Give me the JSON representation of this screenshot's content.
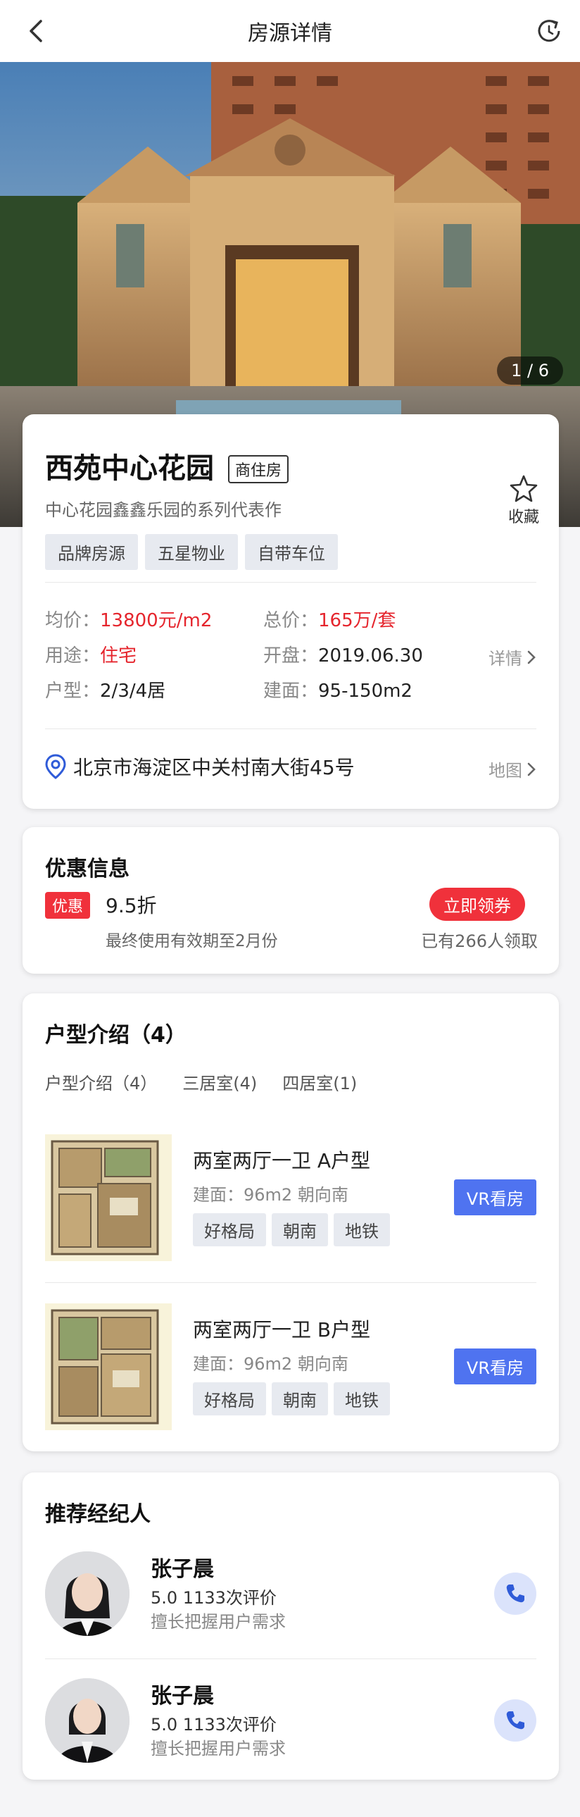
{
  "header": {
    "title": "房源详情"
  },
  "gallery": {
    "counter": "1 / 6"
  },
  "property": {
    "name": "西苑中心花园",
    "type": "商住房",
    "collect_label": "收藏",
    "description": "中心花园鑫鑫乐园的系列代表作",
    "tags": [
      "品牌房源",
      "五星物业",
      "自带车位"
    ],
    "avg_price_label": "均价：",
    "avg_price": "13800元/m2",
    "total_price_label": "总价：",
    "total_price": "165万/套",
    "usage_label": "用途：",
    "usage": "住宅",
    "open_label": "开盘：",
    "open_date": "2019.06.30",
    "layout_label": "户型：",
    "layout": "2/3/4居",
    "area_label": "建面：",
    "area": "95-150m2",
    "detail_link": "详情",
    "address": "北京市海淀区中关村南大街45号",
    "map_link": "地图"
  },
  "coupon": {
    "title": "优惠信息",
    "badge": "优惠",
    "discount": "9.5折",
    "expiry": "最终使用有效期至2月份",
    "button": "立即领券",
    "received": "已有266人领取"
  },
  "floorplans": {
    "title": "户型介绍（4）",
    "tabs": [
      "户型介绍（4）",
      "三居室(4)",
      "四居室(1)"
    ],
    "items": [
      {
        "name": "两室两厅一卫 A户型",
        "info": "建面：96m2 朝向南",
        "tags": [
          "好格局",
          "朝南",
          "地铁"
        ],
        "button": "VR看房"
      },
      {
        "name": "两室两厅一卫 B户型",
        "info": "建面：96m2 朝向南",
        "tags": [
          "好格局",
          "朝南",
          "地铁"
        ],
        "button": "VR看房"
      }
    ]
  },
  "agents": {
    "title": "推荐经纪人",
    "items": [
      {
        "name": "张子晨",
        "rating": "5.0 1133次评价",
        "specialty": "擅长把握用户需求"
      },
      {
        "name": "张子晨",
        "rating": "5.0 1133次评价",
        "specialty": "擅长把握用户需求"
      }
    ]
  },
  "colors": {
    "accent_red": "#e5252d",
    "vr_blue": "#4f73f0",
    "phone_blue": "#2f5bd8"
  }
}
